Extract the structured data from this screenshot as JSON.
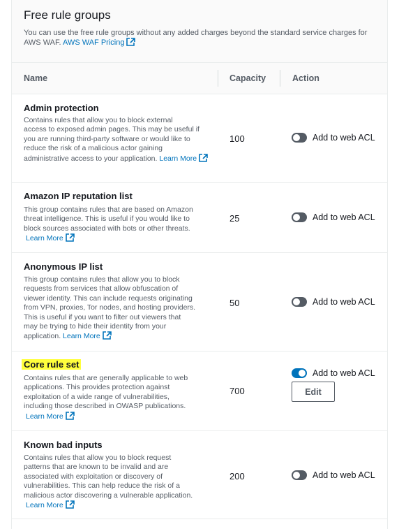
{
  "panel": {
    "title": "Free rule groups",
    "description_line1": "You can use the free rule groups without any added charges beyond the standard service charges for",
    "description_line2": "AWS WAF.",
    "pricing_link": "AWS WAF Pricing"
  },
  "table": {
    "headers": {
      "name": "Name",
      "capacity": "Capacity",
      "action": "Action"
    },
    "rows": [
      {
        "name": "Admin protection",
        "desc": [
          "Contains rules that allow you to block external",
          "access to exposed admin pages. This may be useful if",
          "you are running third-party software or would like to",
          "reduce the risk of a malicious actor gaining",
          "administrative access to your application."
        ],
        "learn_more": "Learn More",
        "capacity": "100",
        "action": "Add to web ACL",
        "enabled": false
      },
      {
        "name": "Amazon IP reputation list",
        "desc": [
          "This group contains rules that are based on Amazon",
          "threat intelligence. This is useful if you would like to",
          "block sources associated with bots or other threats."
        ],
        "learn_more": "Learn More",
        "capacity": "25",
        "action": "Add to web ACL",
        "enabled": false
      },
      {
        "name": "Anonymous IP list",
        "desc": [
          "This group contains rules that allow you to block",
          "requests from services that allow obfuscation of",
          "viewer identity. This can include requests originating",
          "from VPN, proxies, Tor nodes, and hosting providers.",
          "This is useful if you want to filter out viewers that",
          "may be trying to hide their identity from your",
          "application."
        ],
        "learn_more": "Learn More",
        "capacity": "50",
        "action": "Add to web ACL",
        "enabled": false
      },
      {
        "name": "Core rule set",
        "desc": [
          "Contains rules that are generally applicable to web",
          "applications. This provides protection against",
          "exploitation of a wide range of vulnerabilities,",
          "including those described in OWASP publications."
        ],
        "learn_more": "Learn More",
        "capacity": "700",
        "action": "Add to web ACL",
        "enabled": true,
        "edit_label": "Edit"
      },
      {
        "name": "Known bad inputs",
        "desc": [
          "Contains rules that allow you to block request",
          "patterns that are known to be invalid and are",
          "associated with exploitation or discovery of",
          "vulnerabilities. This can help reduce the risk of a",
          "malicious actor discovering a vulnerable application."
        ],
        "learn_more": "Learn More",
        "capacity": "200",
        "action": "Add to web ACL",
        "enabled": false
      }
    ]
  },
  "colors": {
    "link": "#0073bb",
    "toggle_on": "#0073bb",
    "toggle_off": "#545b64",
    "highlight": "#ffff3c"
  },
  "icons": {
    "external_link": "external-link-icon"
  }
}
